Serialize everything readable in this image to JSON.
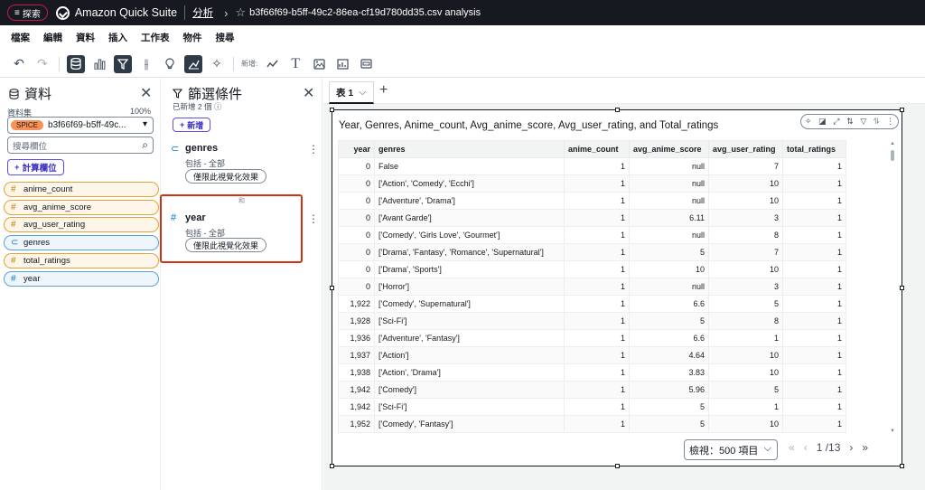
{
  "topbar": {
    "explore_label": "探索",
    "brand": "Amazon Quick Suite",
    "crumb_link": "分析",
    "file_title": "b3f66f69-b5ff-49c2-86ea-cf19d780dd35.csv analysis"
  },
  "menu": [
    "檔案",
    "編輯",
    "資料",
    "插入",
    "工作表",
    "物件",
    "搜尋"
  ],
  "toolbar": {
    "new_label": "新增:"
  },
  "data_panel": {
    "title": "資料",
    "dataset_label": "資料集",
    "dataset_pct": "100%",
    "spice": "SPICE",
    "dataset_name": "b3f66f69-b5ff-49c...",
    "search_placeholder": "搜尋欄位",
    "calc_label": "計算欄位",
    "fields": [
      {
        "name": "anime_count",
        "kind": "measure"
      },
      {
        "name": "avg_anime_score",
        "kind": "measure"
      },
      {
        "name": "avg_user_rating",
        "kind": "measure"
      },
      {
        "name": "genres",
        "kind": "dimension"
      },
      {
        "name": "total_ratings",
        "kind": "measure"
      },
      {
        "name": "year",
        "kind": "dimension"
      }
    ]
  },
  "filter_panel": {
    "title": "篩選條件",
    "subtitle": "已新增 2 個",
    "add_label": "新增",
    "and_label": "和",
    "filters": [
      {
        "name": "genres",
        "sub": "包括 - 全部",
        "pill": "僅限此視覺化效果"
      },
      {
        "name": "year",
        "sub": "包括 - 全部",
        "pill": "僅限此視覺化效果"
      }
    ]
  },
  "sheet": {
    "tab_label": "表 1"
  },
  "visual": {
    "title": "Year, Genres, Anime_count, Avg_anime_score, Avg_user_rating, and Total_ratings",
    "columns": [
      "year",
      "genres",
      "anime_count",
      "avg_anime_score",
      "avg_user_rating",
      "total_ratings"
    ],
    "rows": [
      [
        "0",
        "False",
        "1",
        "null",
        "7",
        "1"
      ],
      [
        "0",
        "['Action', 'Comedy', 'Ecchi']",
        "1",
        "null",
        "10",
        "1"
      ],
      [
        "0",
        "['Adventure', 'Drama']",
        "1",
        "null",
        "10",
        "1"
      ],
      [
        "0",
        "['Avant Garde']",
        "1",
        "6.11",
        "3",
        "1"
      ],
      [
        "0",
        "['Comedy', 'Girls Love', 'Gourmet']",
        "1",
        "null",
        "8",
        "1"
      ],
      [
        "0",
        "['Drama', 'Fantasy', 'Romance', 'Supernatural']",
        "1",
        "5",
        "7",
        "1"
      ],
      [
        "0",
        "['Drama', 'Sports']",
        "1",
        "10",
        "10",
        "1"
      ],
      [
        "0",
        "['Horror']",
        "1",
        "null",
        "3",
        "1"
      ],
      [
        "1,922",
        "['Comedy', 'Supernatural']",
        "1",
        "6.6",
        "5",
        "1"
      ],
      [
        "1,928",
        "['Sci-Fi']",
        "1",
        "5",
        "8",
        "1"
      ],
      [
        "1,936",
        "['Adventure', 'Fantasy']",
        "1",
        "6.6",
        "1",
        "1"
      ],
      [
        "1,937",
        "['Action']",
        "1",
        "4.64",
        "10",
        "1"
      ],
      [
        "1,938",
        "['Action', 'Drama']",
        "1",
        "3.83",
        "10",
        "1"
      ],
      [
        "1,942",
        "['Comedy']",
        "1",
        "5.96",
        "5",
        "1"
      ],
      [
        "1,942",
        "['Sci-Fi']",
        "1",
        "5",
        "1",
        "1"
      ],
      [
        "1,952",
        "['Comedy', 'Fantasy']",
        "1",
        "5",
        "10",
        "1"
      ]
    ],
    "page_size_label": "檢視：500 項目",
    "page_current": "1",
    "page_total": "/13"
  }
}
